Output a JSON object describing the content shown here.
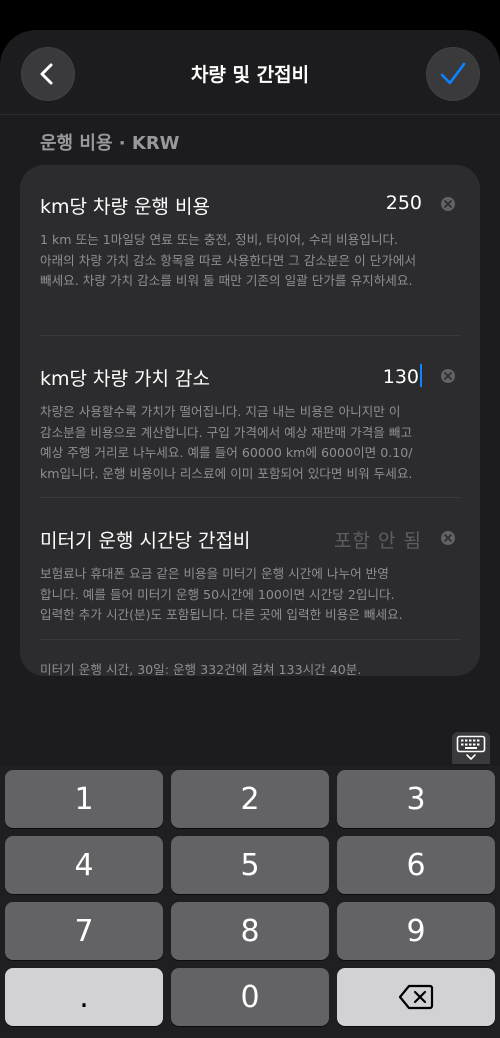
{
  "nav": {
    "title": "차량 및 간접비",
    "back_icon": "chevron-left-icon",
    "done_icon": "checkmark-icon",
    "accent_color": "#0a84ff"
  },
  "section": {
    "header": "운행 비용 · KRW"
  },
  "rows": [
    {
      "label": "km당 차량 운행 비용",
      "value": "250",
      "description": [
        "1 km 또는 1마일당 연료 또는 충전, 정비, 타이어, 수리 비용입니다.",
        "아래의 차량 가치 감소 항목을 따로 사용한다면 그 감소분은 이 단가에서",
        "빼세요. 차량 가치 감소를 비워 둘 때만 기존의 일괄 단가를 유지하세요."
      ]
    },
    {
      "label": "km당 차량 가치 감소",
      "value": "130",
      "description": [
        "차량은 사용할수록 가치가 떨어집니다. 지금 내는 비용은 아니지만 이",
        "감소분을 비용으로 계산합니다. 구입 가격에서 예상 재판매 가격을 빼고",
        "예상 주행 거리로 나누세요. 예를 들어 60000 km에 6000이면 0.10/",
        "km입니다. 운행 비용이나 리스료에 이미 포함되어 있다면 비워 두세요."
      ]
    },
    {
      "label": "미터기 운행 시간당 간접비",
      "placeholder": "포함 안 됨",
      "description": [
        "보험료나 휴대폰 요금 같은 비용을 미터기 운행 시간에 나누어 반영",
        "합니다. 예를 들어 미터기 운행 50시간에 100이면 시간당 2입니다.",
        "입력한 추가 시간(분)도 포함됩니다. 다른 곳에 입력한 비용은 빼세요."
      ]
    }
  ],
  "footer": "미터기 운행 시간, 30일: 운행 332건에 걸쳐 133시간 40분.",
  "keyboard": {
    "toggle_icon": "keyboard-dismiss-icon",
    "keys": [
      "1",
      "2",
      "3",
      "4",
      "5",
      "6",
      "7",
      "8",
      "9",
      ".",
      "0"
    ],
    "delete_icon": "backspace-icon"
  }
}
